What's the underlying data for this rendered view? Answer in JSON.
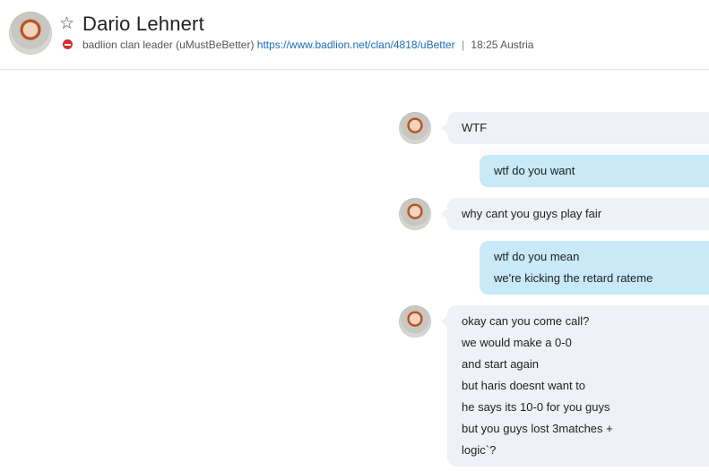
{
  "contact": {
    "name": "Dario Lehnert",
    "mood_text": "badlion clan leader (uMustBeBetter)",
    "mood_link": "https://www.badlion.net/clan/4818/uBetter",
    "separator": "|",
    "local_time": "18:25 Austria",
    "status": "do-not-disturb",
    "status_color": "#d92b2b"
  },
  "icons": {
    "favorite": "star-outline-icon",
    "status": "do-not-disturb-icon"
  },
  "colors": {
    "incoming_bubble": "#eef1f5",
    "outgoing_bubble": "#c7e9f8",
    "link": "#1d6bb5"
  },
  "messages": [
    {
      "direction": "incoming",
      "lines": [
        "WTF"
      ]
    },
    {
      "direction": "outgoing",
      "lines": [
        "wtf do you want"
      ]
    },
    {
      "direction": "incoming",
      "lines": [
        "why cant you guys play fair"
      ]
    },
    {
      "direction": "outgoing",
      "lines": [
        "wtf do you mean",
        "we're kicking the retard rateme"
      ]
    },
    {
      "direction": "incoming",
      "lines": [
        "okay can you come call?",
        "we would make a 0-0",
        "and start again",
        "but haris doesnt want to",
        "he says its 10-0 for you guys",
        "but you guys lost 3matches +",
        "logic`?"
      ]
    }
  ]
}
